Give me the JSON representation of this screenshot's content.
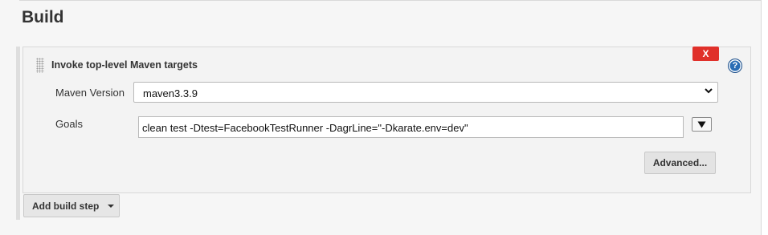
{
  "section": {
    "title": "Build"
  },
  "step": {
    "title": "Invoke top-level Maven targets",
    "delete_label": "X",
    "help_label": "?",
    "maven_version_label": "Maven Version",
    "maven_version_value": "maven3.3.9",
    "goals_label": "Goals",
    "goals_value": "clean test -Dtest=FacebookTestRunner -DagrLine=\"-Dkarate.env=dev\"",
    "advanced_label": "Advanced..."
  },
  "footer": {
    "add_build_step_label": "Add build step"
  },
  "colors": {
    "delete_button": "#e0302a",
    "help_icon": "#2a6db5"
  },
  "icons": {
    "drag": "drag-handle-icon",
    "help": "help-icon",
    "select": "chevron-down-icon",
    "expand": "triangle-down-icon",
    "menu": "caret-down-icon"
  }
}
